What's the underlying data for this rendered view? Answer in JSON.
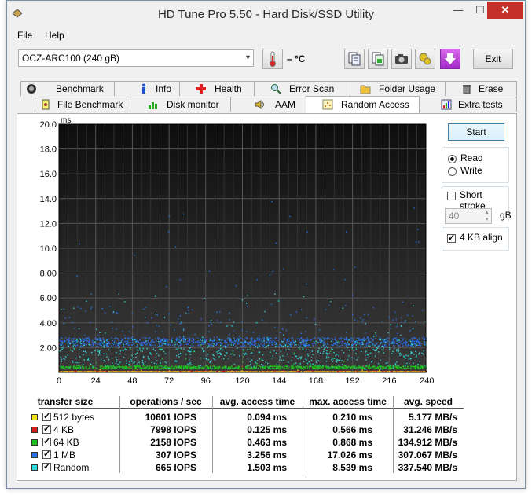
{
  "window": {
    "title": "HD Tune Pro 5.50 - Hard Disk/SSD Utility"
  },
  "menu": {
    "file": "File",
    "help": "Help"
  },
  "toolbar": {
    "drive": "OCZ-ARC100 (240 gB)",
    "temperature": "– °C",
    "exit_label": "Exit",
    "buttons": [
      "copy-text-icon",
      "copy-screenshot-icon",
      "camera-icon",
      "options-icon",
      "save-download-icon"
    ]
  },
  "tabs": {
    "row1": [
      "Benchmark",
      "Info",
      "Health",
      "Error Scan",
      "Folder Usage",
      "Erase"
    ],
    "row2": [
      "File Benchmark",
      "Disk monitor",
      "AAM",
      "Random Access",
      "Extra tests"
    ],
    "active": "Random Access"
  },
  "controls": {
    "start_label": "Start",
    "read_label": "Read",
    "write_label": "Write",
    "mode": "Read",
    "short_stroke_label": "Short stroke",
    "short_stroke_checked": false,
    "short_stroke_value": "40",
    "short_stroke_unit": "gB",
    "align_label": "4 KB align",
    "align_checked": true
  },
  "chart_data": {
    "type": "scatter",
    "ylabel": "ms",
    "ylim": [
      0,
      20
    ],
    "yticks": [
      "20.0",
      "18.0",
      "16.0",
      "14.0",
      "12.0",
      "10.0",
      "8.00",
      "6.00",
      "4.00",
      "2.00"
    ],
    "xlim": [
      0,
      240
    ],
    "xticks": [
      "0",
      "24",
      "48",
      "72",
      "96",
      "120",
      "144",
      "168",
      "192",
      "216",
      "240gB"
    ],
    "grid": true,
    "background": "#1c1c1c",
    "series": [
      {
        "name": "512 bytes",
        "color": "#f0e020",
        "band_ms": 0.094,
        "max_ms": 0.21
      },
      {
        "name": "4 KB",
        "color": "#d02020",
        "band_ms": 0.125,
        "max_ms": 0.566
      },
      {
        "name": "64 KB",
        "color": "#20c020",
        "band_ms": 0.463,
        "max_ms": 0.868
      },
      {
        "name": "1 MB",
        "color": "#2a6ee6",
        "band_ms": 2.5,
        "max_ms": 17.026
      },
      {
        "name": "Random",
        "color": "#30d8d8",
        "band_ms": 1.503,
        "max_ms": 8.539
      }
    ]
  },
  "results": {
    "headers": [
      "transfer size",
      "operations / sec",
      "avg. access time",
      "max. access time",
      "avg. speed"
    ],
    "rows": [
      {
        "name": "512 bytes",
        "color": "#f0e020",
        "checked": true,
        "ops": "10601 IOPS",
        "avg": "0.094 ms",
        "max": "0.210 ms",
        "speed": "5.177 MB/s"
      },
      {
        "name": "4 KB",
        "color": "#d02020",
        "checked": true,
        "ops": "7998 IOPS",
        "avg": "0.125 ms",
        "max": "0.566 ms",
        "speed": "31.246 MB/s"
      },
      {
        "name": "64 KB",
        "color": "#20c020",
        "checked": true,
        "ops": "2158 IOPS",
        "avg": "0.463 ms",
        "max": "0.868 ms",
        "speed": "134.912 MB/s"
      },
      {
        "name": "1 MB",
        "color": "#2a6ee6",
        "checked": true,
        "ops": "307 IOPS",
        "avg": "3.256 ms",
        "max": "17.026 ms",
        "speed": "307.067 MB/s"
      },
      {
        "name": "Random",
        "color": "#30d8d8",
        "checked": true,
        "ops": "665 IOPS",
        "avg": "1.503 ms",
        "max": "8.539 ms",
        "speed": "337.540 MB/s"
      }
    ]
  }
}
